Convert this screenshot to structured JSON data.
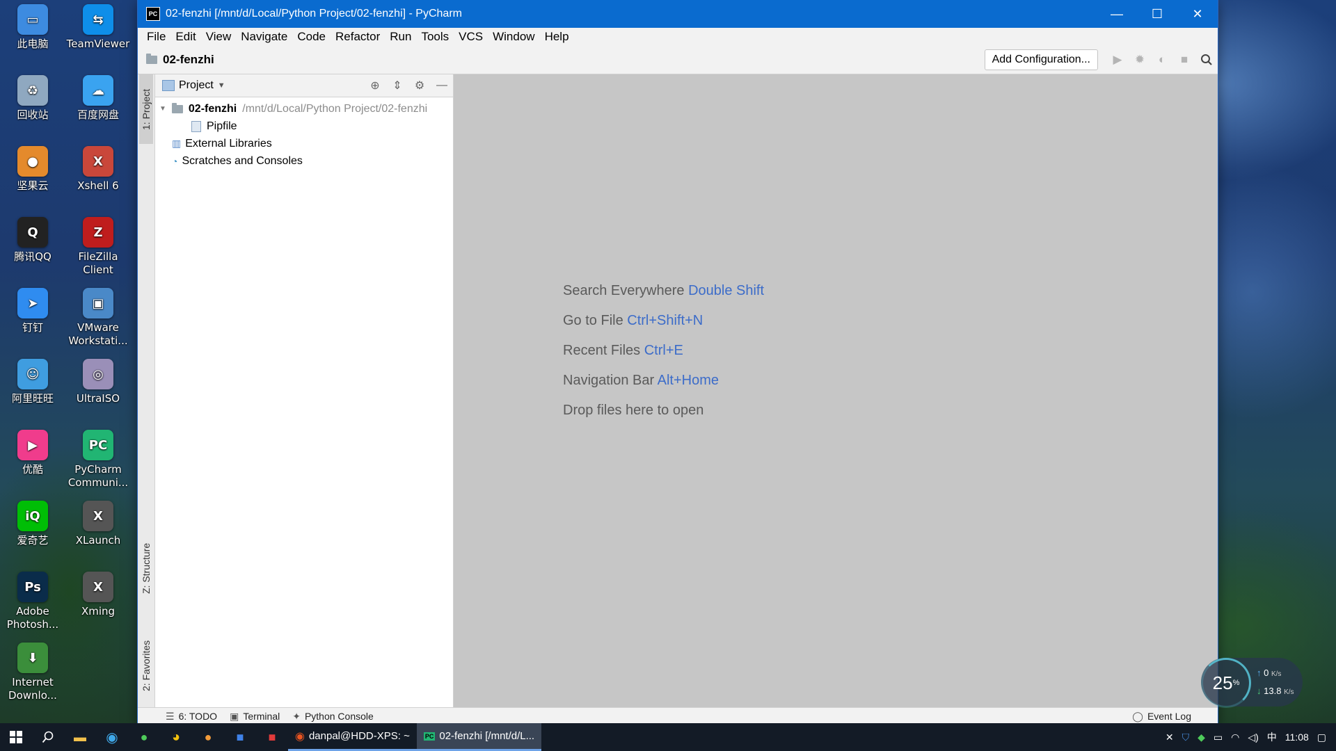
{
  "desktop": {
    "icons": [
      {
        "label": "此电脑",
        "icon": "computer-icon",
        "color": "#3d8be0",
        "glyph": "▭"
      },
      {
        "label": "TeamViewer",
        "icon": "teamviewer-icon",
        "color": "#0e8ee9",
        "glyph": "⇆"
      },
      {
        "label": "回收站",
        "icon": "recycle-bin-icon",
        "color": "#8fa8c0",
        "glyph": "♻"
      },
      {
        "label": "百度网盘",
        "icon": "baidu-netdisk-icon",
        "color": "#3aa3f0",
        "glyph": "☁"
      },
      {
        "label": "坚果云",
        "icon": "jianguoyun-icon",
        "color": "#e48a2c",
        "glyph": "●"
      },
      {
        "label": "Xshell 6",
        "icon": "xshell-icon",
        "color": "#c9473a",
        "glyph": "X"
      },
      {
        "label": "腾讯QQ",
        "icon": "qq-icon",
        "color": "#222222",
        "glyph": "Q"
      },
      {
        "label": "FileZilla Client",
        "icon": "filezilla-icon",
        "color": "#bf1d1d",
        "glyph": "Z"
      },
      {
        "label": "钉钉",
        "icon": "dingtalk-icon",
        "color": "#2f8cf0",
        "glyph": "➤"
      },
      {
        "label": "VMware Workstati...",
        "icon": "vmware-icon",
        "color": "#4a89c8",
        "glyph": "▣"
      },
      {
        "label": "阿里旺旺",
        "icon": "aliwangwang-icon",
        "color": "#3f9de0",
        "glyph": "☺"
      },
      {
        "label": "UltraISO",
        "icon": "ultraiso-icon",
        "color": "#9a8fb8",
        "glyph": "◎"
      },
      {
        "label": "优酷",
        "icon": "youku-icon",
        "color": "#f03c8c",
        "glyph": "▶"
      },
      {
        "label": "PyCharm Communi...",
        "icon": "pycharm-icon",
        "color": "#21b573",
        "glyph": "PC"
      },
      {
        "label": "爱奇艺",
        "icon": "iqiyi-icon",
        "color": "#00be06",
        "glyph": "iQ"
      },
      {
        "label": "XLaunch",
        "icon": "xlaunch-icon",
        "color": "#555555",
        "glyph": "X"
      },
      {
        "label": "Adobe Photosh...",
        "icon": "photoshop-icon",
        "color": "#0a2c4a",
        "glyph": "Ps"
      },
      {
        "label": "Xming",
        "icon": "xming-icon",
        "color": "#555555",
        "glyph": "X"
      },
      {
        "label": "Internet Downlo...",
        "icon": "internet-download-icon",
        "color": "#3b8e3b",
        "glyph": "⬇"
      }
    ]
  },
  "window": {
    "title": "02-fenzhi [/mnt/d/Local/Python Project/02-fenzhi] - PyCharm",
    "controls": {
      "minimize": "—",
      "maximize": "☐",
      "close": "✕"
    }
  },
  "menu": [
    "File",
    "Edit",
    "View",
    "Navigate",
    "Code",
    "Refactor",
    "Run",
    "Tools",
    "VCS",
    "Window",
    "Help"
  ],
  "navbar": {
    "breadcrumb": "02-fenzhi",
    "add_configuration": "Add Configuration..."
  },
  "side_tabs": {
    "project": "1: Project",
    "structure": "Z: Structure",
    "favorites": "2: Favorites"
  },
  "project_panel": {
    "title": "Project",
    "tree": [
      {
        "name": "02-fenzhi",
        "path": "/mnt/d/Local/Python Project/02-fenzhi",
        "type": "folder",
        "expanded": true
      },
      {
        "name": "Pipfile",
        "type": "file"
      },
      {
        "name": "External Libraries",
        "type": "libraries"
      },
      {
        "name": "Scratches and Consoles",
        "type": "scratches"
      }
    ]
  },
  "editor_hints": [
    {
      "text": "Search Everywhere",
      "key": "Double Shift"
    },
    {
      "text": "Go to File",
      "key": "Ctrl+Shift+N"
    },
    {
      "text": "Recent Files",
      "key": "Ctrl+E"
    },
    {
      "text": "Navigation Bar",
      "key": "Alt+Home"
    },
    {
      "text": "Drop files here to open",
      "key": ""
    }
  ],
  "bottom_tools": {
    "todo": "6: TODO",
    "terminal": "Terminal",
    "python_console": "Python Console",
    "event_log": "Event Log"
  },
  "monitor": {
    "cpu_percent": "25",
    "percent_sign": "%",
    "upload": "0",
    "upload_unit": "K/s",
    "download": "13.8",
    "download_unit": "K/s"
  },
  "taskbar": {
    "apps": [
      {
        "label": "danpal@HDD-XPS: ~",
        "icon": "ubuntu-icon",
        "active": false
      },
      {
        "label": "02-fenzhi [/mnt/d/L...",
        "icon": "pycharm-icon",
        "active": true
      }
    ],
    "clock": "11:08"
  },
  "colors": {
    "titlebar": "#0a6bcf",
    "editor_bg": "#c6c6c6",
    "shortcut_key": "#3c6cc9"
  }
}
